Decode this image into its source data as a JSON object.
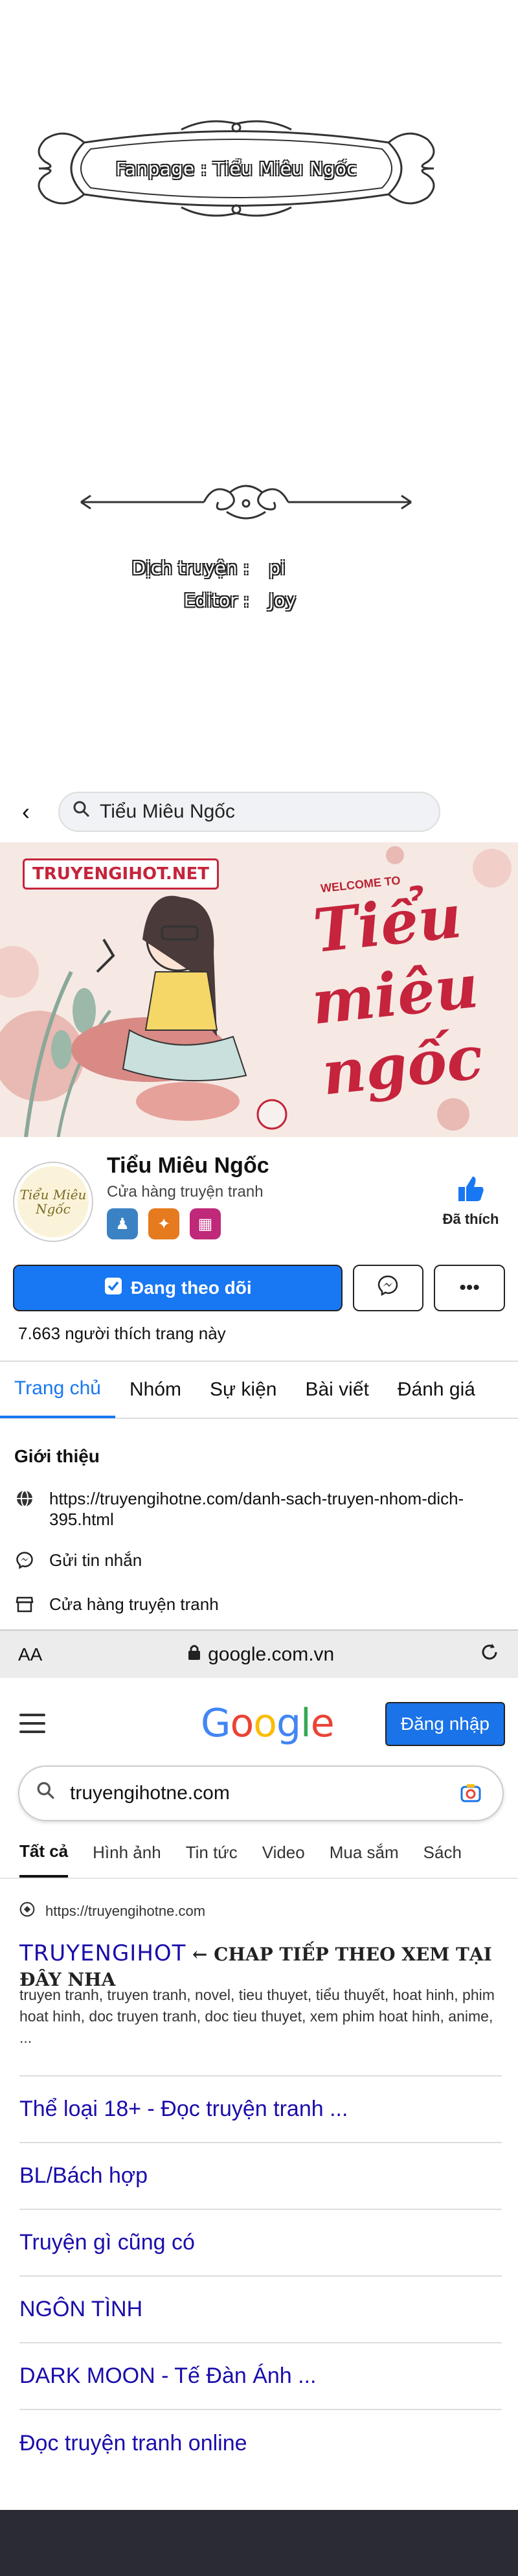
{
  "credits": {
    "fanpage_label": "Fanpage : Tiểu Miêu Ngốc",
    "translator_key": "Dịch truyện :",
    "translator_value": "pi",
    "editor_key": "Editor :",
    "editor_value": "Joy"
  },
  "facebook": {
    "search_text": "Tiểu Miêu Ngốc",
    "cover": {
      "site_label": "TRUYENGIHOT.NET",
      "welcome": "WELCOME TO",
      "title_line1": "Tiểu",
      "title_line2": "miêu",
      "title_line3": "ngốc"
    },
    "page_name": "Tiểu Miêu Ngốc",
    "page_category": "Cửa hàng truyện tranh",
    "liked_label": "Đã thích",
    "following_label": "Đang theo dõi",
    "more_label": "•••",
    "likes_text": "7.663 người thích trang này",
    "tabs": [
      {
        "label": "Trang chủ"
      },
      {
        "label": "Nhóm"
      },
      {
        "label": "Sự kiện"
      },
      {
        "label": "Bài viết"
      },
      {
        "label": "Đánh giá"
      }
    ],
    "intro_title": "Giới thiệu",
    "intro_link": "https://truyengihotne.com/danh-sach-truyen-nhom-dich-395.html",
    "intro_message": "Gửi tin nhắn",
    "intro_shop": "Cửa hàng truyện tranh"
  },
  "browser": {
    "aa_label": "AA",
    "url": "google.com.vn"
  },
  "google": {
    "logo_letters": [
      "G",
      "o",
      "o",
      "g",
      "l",
      "e"
    ],
    "logo_colors": [
      "#4285F4",
      "#EA4335",
      "#FBBC05",
      "#4285F4",
      "#34A853",
      "#EA4335"
    ],
    "signin_label": "Đăng nhập",
    "query": "truyengihotne.com",
    "tabs": [
      {
        "label": "Tất cả"
      },
      {
        "label": "Hình ảnh"
      },
      {
        "label": "Tin tức"
      },
      {
        "label": "Video"
      },
      {
        "label": "Mua sắm"
      },
      {
        "label": "Sách"
      }
    ],
    "result": {
      "url": "https://truyengihotne.com",
      "title_site": "TRUYENGIHOT",
      "title_promo": "← CHAP TIẾP THEO XEM TẠI ĐÂY NHA",
      "snippet": "truyen tranh, truyen tranh, novel, tieu thuyet, tiểu thuyết, hoat hinh, phim hoat hinh, doc truyen tranh, doc tieu thuyet, xem phim hoat hinh, anime, ..."
    },
    "sitelinks": [
      {
        "label": "Thể loại 18+ - Đọc truyện tranh ..."
      },
      {
        "label": "BL/Bách hợp"
      },
      {
        "label": "Truyện gì cũng có"
      },
      {
        "label": "NGÔN TÌNH"
      },
      {
        "label": "DARK MOON - Tế Đàn Ánh ..."
      },
      {
        "label": "Đọc truyện tranh online"
      }
    ]
  }
}
